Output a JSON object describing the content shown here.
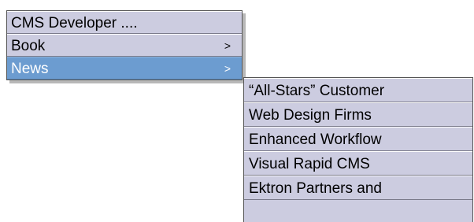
{
  "main_menu": {
    "items": [
      {
        "label": "CMS Developer ....",
        "arrow": ""
      },
      {
        "label": "Book",
        "arrow": ">"
      },
      {
        "label": "News",
        "arrow": ">"
      }
    ]
  },
  "sub_menu": {
    "items": [
      {
        "label": "“All-Stars” Customer"
      },
      {
        "label": "Web Design Firms"
      },
      {
        "label": "Enhanced Workflow"
      },
      {
        "label": "Visual Rapid CMS"
      },
      {
        "label": "Ektron Partners and"
      }
    ]
  },
  "colors": {
    "menu_bg": "#cccce0",
    "selected_bg": "#6c9cd0"
  }
}
